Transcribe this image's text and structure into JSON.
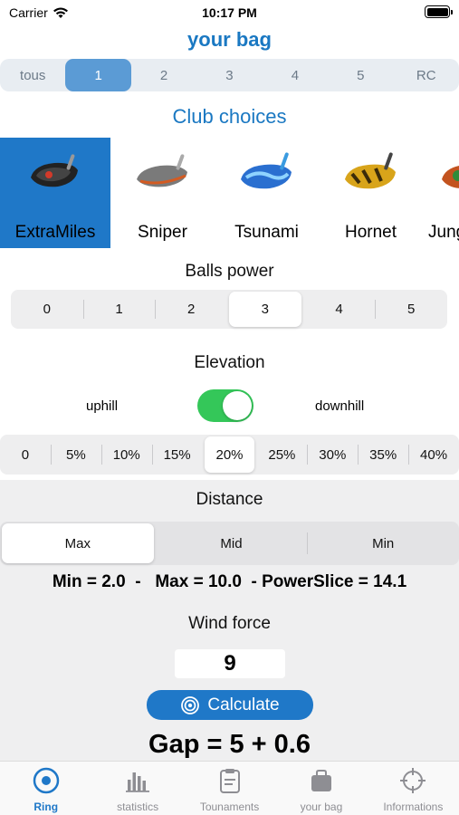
{
  "status": {
    "carrier": "Carrier",
    "time": "10:17 PM"
  },
  "title": "your bag",
  "bag_tabs": [
    "tous",
    "1",
    "2",
    "3",
    "4",
    "5",
    "RC"
  ],
  "bag_tabs_selected": "1",
  "club_section_title": "Club choices",
  "clubs": [
    "ExtraMiles",
    "Sniper",
    "Tsunami",
    "Hornet",
    "Jung"
  ],
  "clubs_selected": "ExtraMiles",
  "balls_power": {
    "label": "Balls power",
    "options": [
      "0",
      "1",
      "2",
      "3",
      "4",
      "5"
    ],
    "selected": "3"
  },
  "elevation": {
    "label": "Elevation",
    "uphill": "uphill",
    "downhill": "downhill",
    "toggle_on": true,
    "options": [
      "0",
      "5%",
      "10%",
      "15%",
      "20%",
      "25%",
      "30%",
      "35%",
      "40%"
    ],
    "selected": "20%"
  },
  "distance": {
    "label": "Distance",
    "options": [
      "Max",
      "Mid",
      "Min"
    ],
    "selected": "Max"
  },
  "minmax_text": "Min = 2.0  -   Max = 10.0  - PowerSlice = 14.1",
  "wind": {
    "label": "Wind force",
    "value": "9"
  },
  "calculate_label": "Calculate",
  "gap_text": "Gap = 5 + 0.6",
  "tab_bar": [
    {
      "label": "Ring",
      "icon": "ring-icon",
      "active": true
    },
    {
      "label": "statistics",
      "icon": "bar-chart-icon",
      "active": false
    },
    {
      "label": "Tounaments",
      "icon": "clipboard-icon",
      "active": false
    },
    {
      "label": "your bag",
      "icon": "bag-icon",
      "active": false
    },
    {
      "label": "Informations",
      "icon": "crosshair-icon",
      "active": false
    }
  ],
  "colors": {
    "accent": "#1f78c8",
    "toggle": "#34c759",
    "tab_selected": "#5b9bd5"
  }
}
